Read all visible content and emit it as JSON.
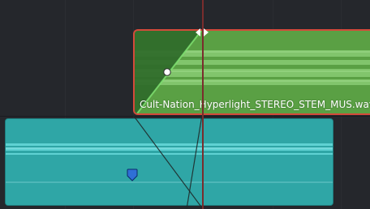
{
  "timeline": {
    "audio_clip": {
      "name": "Cult-Nation_Hyperlight_STEREO_STEM_MUS.wav",
      "selected": true,
      "color": "#5ba046",
      "selection_color": "#d44a3a"
    },
    "lower_clip": {
      "color": "#2fa6a6"
    },
    "fade_handle": {
      "icon": "fade-handle-icon"
    },
    "playhead": {
      "color": "#7a2d2d"
    },
    "marker": {
      "icon": "blue-marker-icon",
      "color": "#2f6fd6"
    }
  }
}
